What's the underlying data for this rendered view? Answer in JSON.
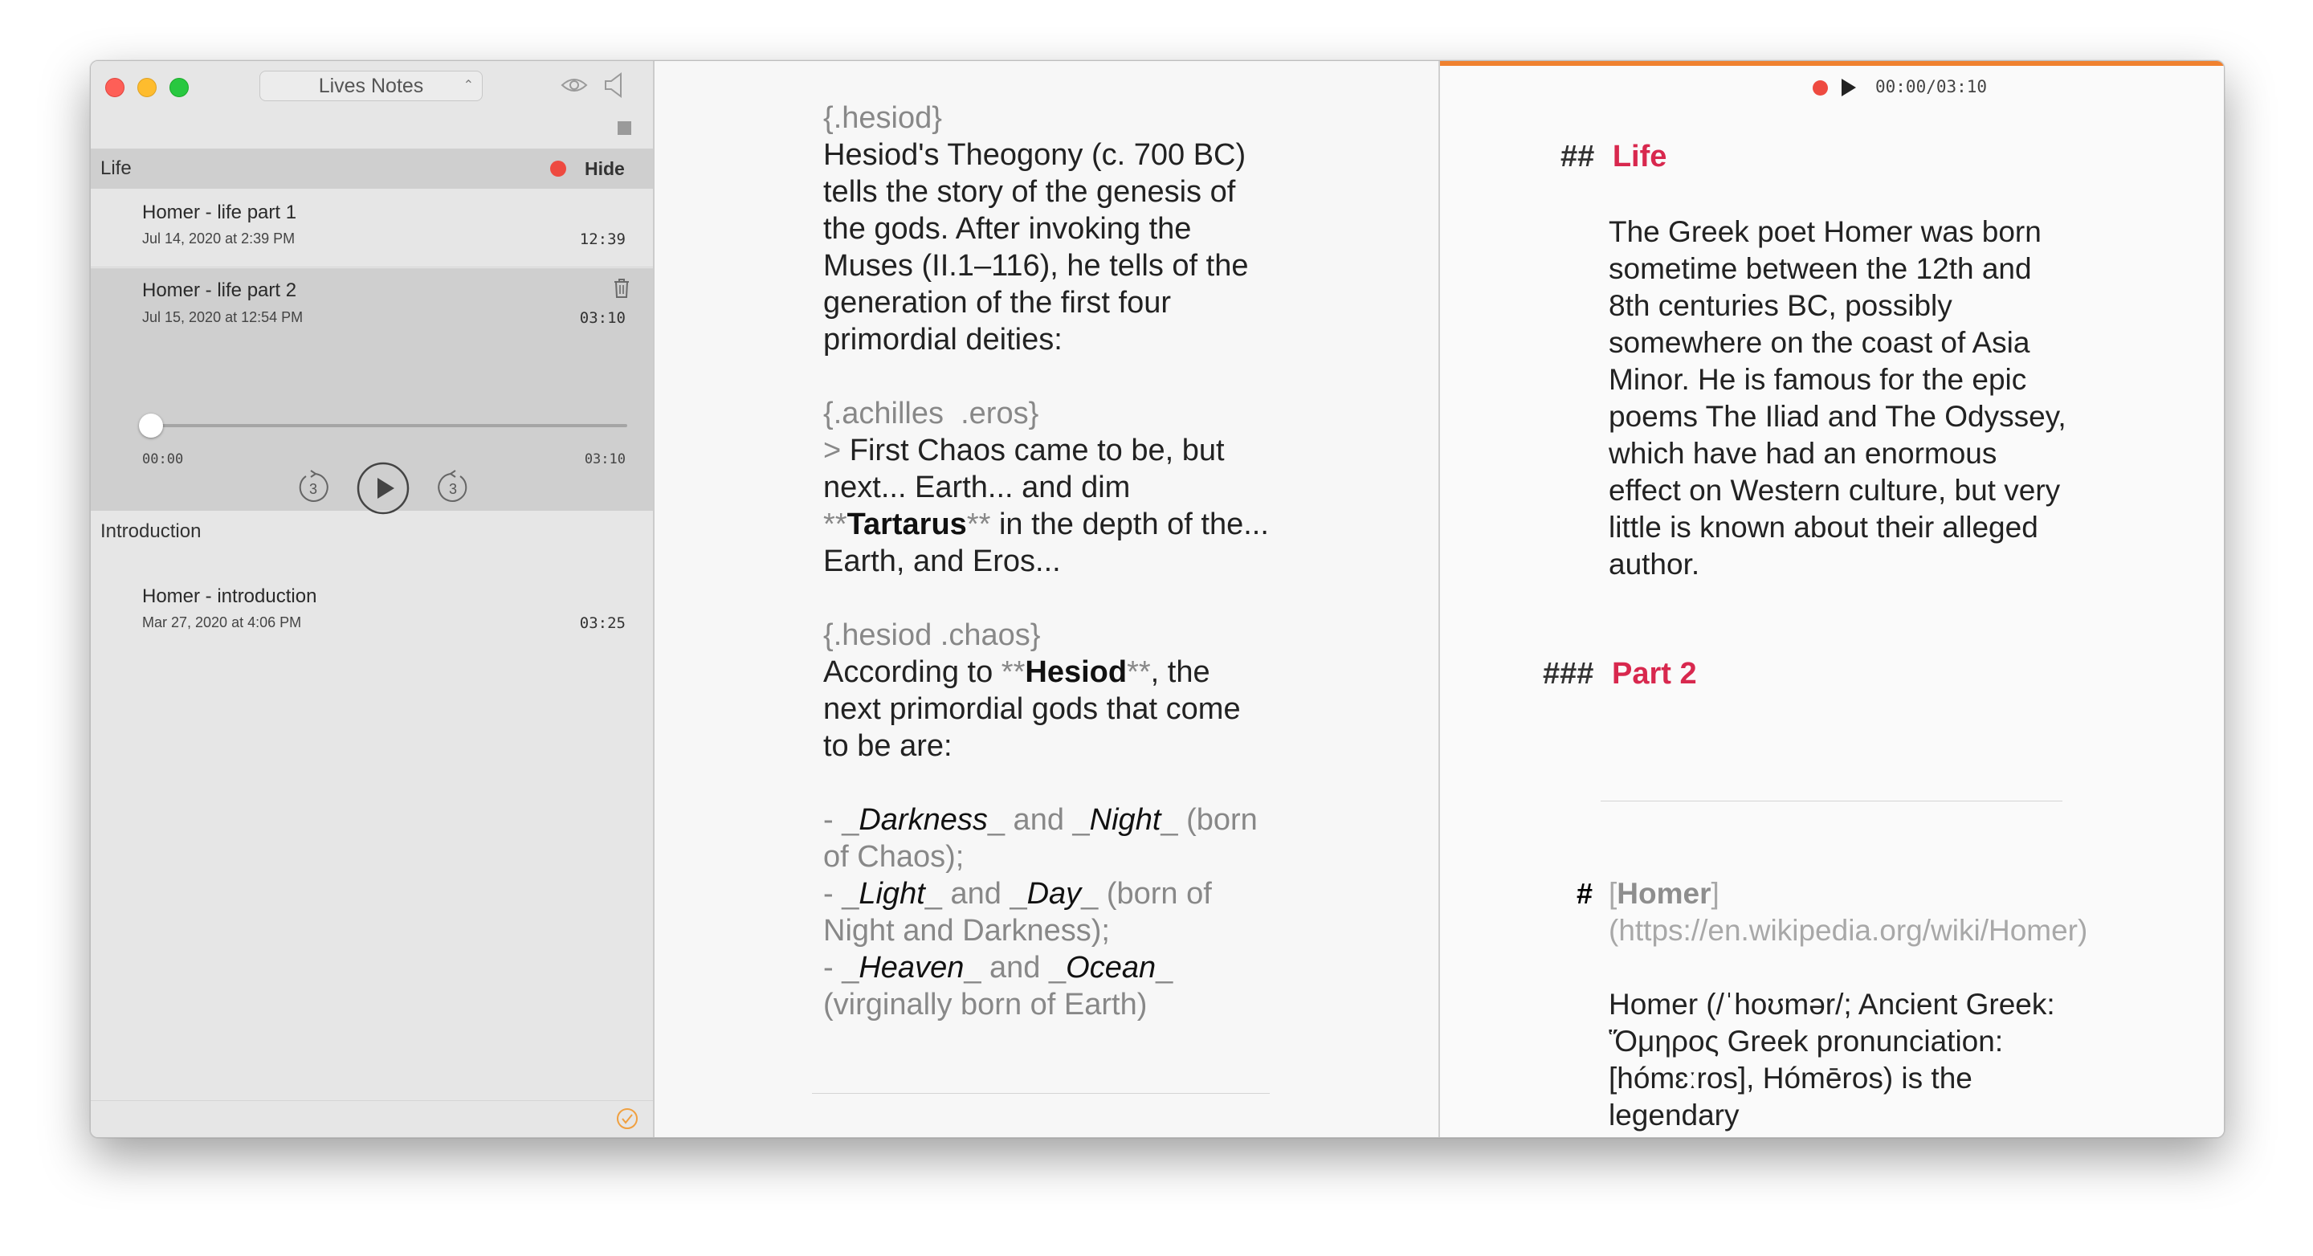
{
  "window": {
    "app_popup_label": "Lives Notes"
  },
  "sidebar": {
    "section_life": {
      "label": "Life",
      "hide_label": "Hide"
    },
    "recordings_life": [
      {
        "title": "Homer - life part 1",
        "date": "Jul 14, 2020 at 2:39 PM",
        "duration": "12:39"
      },
      {
        "title": "Homer - life part 2",
        "date": "Jul 15, 2020 at 12:54 PM",
        "duration": "03:10"
      }
    ],
    "player": {
      "elapsed": "00:00",
      "total": "03:10",
      "skip_seconds": "3"
    },
    "section_intro": {
      "label": "Introduction"
    },
    "recordings_intro": [
      {
        "title": "Homer - introduction",
        "date": "Mar 27, 2020 at 4:06 PM",
        "duration": "03:25"
      }
    ]
  },
  "editor": {
    "block1": {
      "tag_open": "{",
      "tag": ".hesiod",
      "tag_close": "}",
      "text": "Hesiod's Theogony (c. 700 BC) tells the story of the genesis of the gods. After invoking the Muses (II.1–116), he tells of the generation of the first four primordial deities:"
    },
    "block2": {
      "tag_open": "{",
      "tag": ".achilles  .eros",
      "tag_close": "}",
      "quote_marker": ">",
      "text_a": " First Chaos came to be, but next... Earth... and dim ",
      "bold_marker": "**",
      "bold": "Tartarus",
      "text_b": " in the depth of the... Earth, and Eros..."
    },
    "block3": {
      "tag_open": "{",
      "tag": ".hesiod .chaos",
      "tag_close": "}",
      "text_a": "According to ",
      "bold_marker": "**",
      "bold": "Hesiod",
      "text_b": ", the next primordial gods that come to be are:"
    },
    "list": [
      {
        "dash": "- ",
        "u": "_",
        "a": "Darkness",
        "mid": " and ",
        "b": "Night",
        "rest": " (born of Chaos);"
      },
      {
        "dash": "- ",
        "u": "_",
        "a": "Light",
        "mid": " and ",
        "b": "Day",
        "rest": " (born of Night and Darkness);"
      },
      {
        "dash": "- ",
        "u": "_",
        "a": "Heaven",
        "mid": " and ",
        "b": "Ocean",
        "rest": " (virginally born of Earth)"
      }
    ]
  },
  "preview": {
    "player_time": "00:00/03:10",
    "h2_marker": "##",
    "h2": "Life",
    "paragraph1": "The Greek poet Homer was born sometime between the 12th and 8th centuries BC, possibly somewhere on the coast of Asia Minor. He is famous for the epic poems The Iliad and The Odyssey, which have had an enormous effect on Western culture, but very little is known about their alleged author.",
    "h3_marker": "###",
    "h3": "Part 2",
    "h1_marker": "#",
    "link_open": "[",
    "link_text": "Homer",
    "link_url": "](https://en.wikipedia.org/wiki/Homer)",
    "paragraph2": "Homer (/ˈhoʊmər/; Ancient Greek: Ὅμηρος Greek pronunciation: [hómɛːros], Hómēros) is the legendary"
  },
  "colors": {
    "accent_red": "#d8284e",
    "progress_orange": "#f0812f",
    "record_red": "#ee4a40"
  }
}
